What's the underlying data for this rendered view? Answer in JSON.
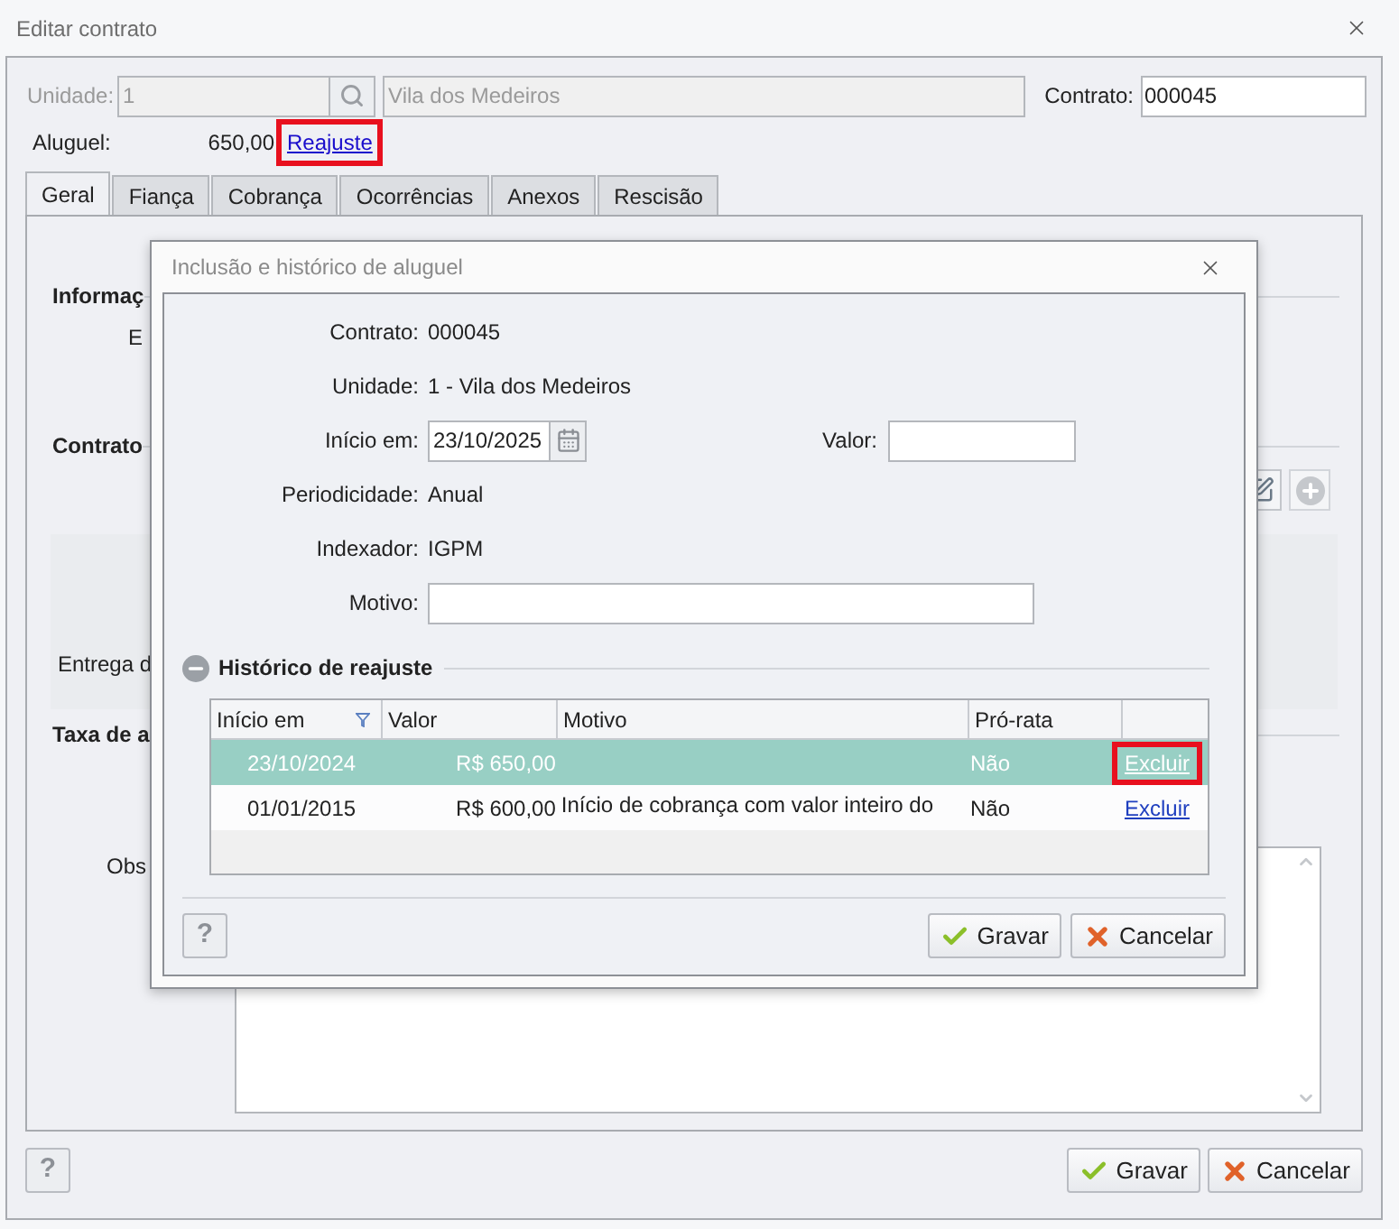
{
  "window": {
    "title": "Editar contrato"
  },
  "header": {
    "unidade_label": "Unidade:",
    "unidade_code": "1",
    "unidade_name": "Vila dos Medeiros",
    "disabled": true,
    "contrato_label": "Contrato:",
    "contrato_value": "000045",
    "aluguel_label": "Aluguel:",
    "aluguel_value": "650,00",
    "reajuste": {
      "label": "Reajuste",
      "highlighted": true
    }
  },
  "tabs": [
    {
      "label": "Geral",
      "selected": true
    },
    {
      "label": "Fiança",
      "selected": false
    },
    {
      "label": "Cobrança",
      "selected": false
    },
    {
      "label": "Ocorrências",
      "selected": false
    },
    {
      "label": "Anexos",
      "selected": false
    },
    {
      "label": "Rescisão",
      "selected": false
    }
  ],
  "form_fragments": {
    "informacoes": "Informaç",
    "en": "E",
    "contrato": "Contrato",
    "entrega": "Entrega d",
    "taxa": "Taxa de a",
    "observacoes": "Obs"
  },
  "help_button": "?",
  "buttons": [
    {
      "label": "Gravar",
      "kind": "save"
    },
    {
      "label": "Cancelar",
      "kind": "cancel"
    }
  ],
  "dialog": {
    "title": "Inclusão e histórico de aluguel",
    "fields": [
      {
        "label": "Contrato:",
        "value": "000045",
        "kind": "text"
      },
      {
        "label": "Unidade:",
        "value": "1 - Vila dos Medeiros",
        "kind": "text"
      },
      {
        "label": "Início em:",
        "value": "23/10/2025",
        "kind": "date",
        "side_label": "Valor:"
      },
      {
        "label": "Periodicidade:",
        "value": "Anual",
        "kind": "text"
      },
      {
        "label": "Indexador:",
        "value": "IGPM",
        "kind": "text"
      },
      {
        "label": "Motivo:",
        "kind": "input"
      }
    ],
    "history": {
      "title": "Histórico de reajuste",
      "expanded": true,
      "columns": [
        "Início em",
        "Valor",
        "Motivo",
        "Pró-rata"
      ],
      "rows": [
        {
          "inicio": "23/10/2024",
          "valor": "R$ 650,00",
          "pro_rata": "Não",
          "action": "Excluir",
          "selected": true,
          "highlighted": true
        },
        {
          "inicio": "01/01/2015",
          "valor": "R$ 600,00",
          "motivo": "Início de cobrança com valor inteiro do",
          "pro_rata": "Não",
          "action": "Excluir",
          "selected": false,
          "highlighted": false
        }
      ]
    },
    "help_button": "?",
    "buttons": [
      {
        "label": "Gravar",
        "kind": "save"
      },
      {
        "label": "Cancelar",
        "kind": "cancel"
      }
    ]
  }
}
